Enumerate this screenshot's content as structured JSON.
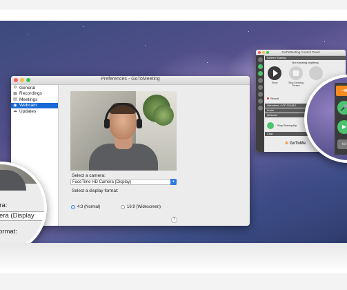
{
  "preferences": {
    "title": "Preferences - GoToMeeting",
    "sidebar": [
      {
        "label": "General",
        "icon": "gear-icon",
        "glyph": "⚙",
        "selected": false
      },
      {
        "label": "Recordings",
        "icon": "recordings-icon",
        "glyph": "▦",
        "selected": false
      },
      {
        "label": "Meetings",
        "icon": "calendar-icon",
        "glyph": "▤",
        "selected": false
      },
      {
        "label": "Webcam",
        "icon": "webcam-icon",
        "glyph": "◉",
        "selected": true
      },
      {
        "label": "Updates",
        "icon": "cloud-icon",
        "glyph": "☁",
        "selected": false
      }
    ],
    "camera_label": "Select a camera:",
    "camera_value": "FaceTime HD Camera (Display)",
    "format_label": "Select a display format:",
    "formats": [
      {
        "label": "4:3 (Normal)",
        "selected": true
      },
      {
        "label": "16:9 (Widescreen)",
        "selected": false
      }
    ],
    "help": "?"
  },
  "control_panel": {
    "title": "GoToMeeting Control Panel",
    "screen_sharing_header": "Screen Sharing",
    "status": "Not showing anything",
    "show_label": "Show",
    "stop_label": "Stop Showing Screen",
    "record_label": "Record",
    "attendees_label": "Attendees: 4 OF 10 MAX",
    "audio_label": "Audio",
    "webcam_label": "Webcam",
    "stop_sharing_label": "Stop Sharing My",
    "chat_label": "Chat",
    "logo_text": "GoToMe"
  },
  "magnifier_left": {
    "camera_label_fragment": "era:",
    "camera_value_fragment": "Camera (Display",
    "format_label_fragment": "y format:"
  },
  "magnifier_right": {
    "arrow_glyph": "⇥",
    "mic_glyph": "🎤",
    "camera_glyph": "▶",
    "screen_glyph": "▭"
  },
  "colors": {
    "selection": "#1a68d6",
    "accent_blue": "#2d7ae5",
    "goto_orange": "#f68b1f",
    "active_green": "#4cc36e"
  }
}
